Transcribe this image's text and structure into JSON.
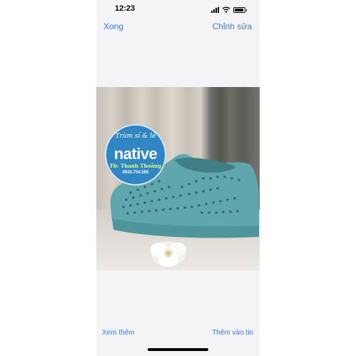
{
  "status_bar": {
    "time": "12:23"
  },
  "nav": {
    "left_label": "Xong",
    "right_label": "Chỉnh sửa"
  },
  "photo": {
    "watermark": {
      "arc_text": "Trùm sỉ & lẻ",
      "brand": "native",
      "fb": "Fb: Thanh Thoảng",
      "phone": "0933.754.555"
    }
  },
  "toolbar": {
    "left_label": "Xem thêm",
    "right_label": "Thêm vào tin"
  },
  "colors": {
    "accent": "#3478f6",
    "shoe": "#5fa6ad",
    "badge": "#2f86c3"
  },
  "icons": [
    "signal-icon",
    "wifi-icon",
    "battery-icon"
  ]
}
